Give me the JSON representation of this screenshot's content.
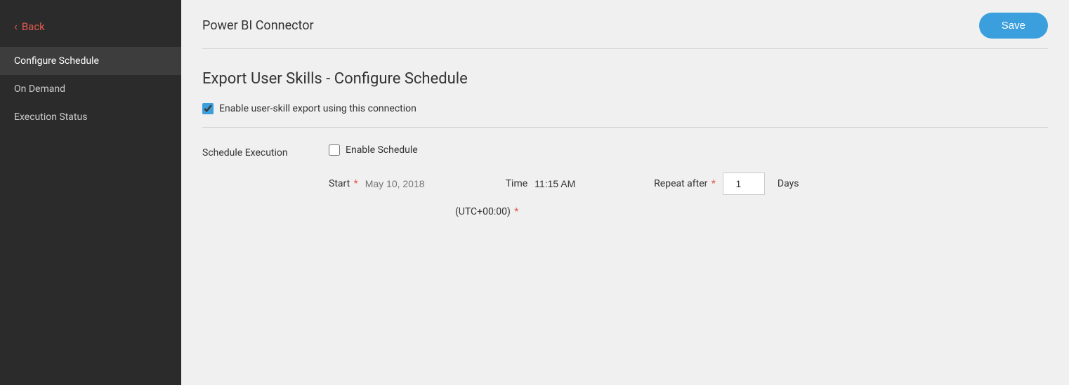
{
  "sidebar": {
    "back_label": "Back",
    "nav_items": [
      {
        "id": "configure-schedule",
        "label": "Configure Schedule",
        "active": true
      },
      {
        "id": "on-demand",
        "label": "On Demand",
        "active": false
      },
      {
        "id": "execution-status",
        "label": "Execution Status",
        "active": false
      }
    ]
  },
  "header": {
    "title": "Power BI Connector",
    "save_button_label": "Save"
  },
  "page": {
    "heading": "Export User Skills - Configure Schedule",
    "enable_checkbox_label": "Enable user-skill export using this connection",
    "enable_checkbox_checked": true,
    "schedule_execution_label": "Schedule Execution",
    "enable_schedule_label": "Enable Schedule",
    "enable_schedule_checked": false,
    "start_label": "Start",
    "start_required": true,
    "start_placeholder": "May 10, 2018",
    "time_label": "Time",
    "time_value": "11:15 AM",
    "utc_label": "(UTC+00:00)",
    "utc_required": true,
    "repeat_after_label": "Repeat after",
    "repeat_after_required": true,
    "repeat_after_value": "1",
    "days_label": "Days"
  }
}
